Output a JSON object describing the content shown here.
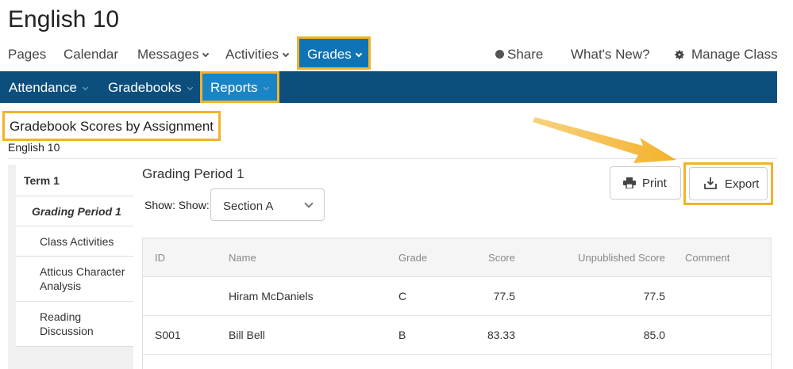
{
  "page": {
    "title": "English 10"
  },
  "topnav": {
    "pages": "Pages",
    "calendar": "Calendar",
    "messages": "Messages",
    "activities": "Activities",
    "grades": "Grades",
    "share": "Share",
    "whats_new": "What's New?",
    "manage_class": "Manage Class"
  },
  "subnav": {
    "attendance": "Attendance",
    "gradebooks": "Gradebooks",
    "reports": "Reports"
  },
  "report": {
    "title": "Gradebook Scores by Assignment",
    "subtitle": "English 10"
  },
  "sidebar": {
    "term": "Term 1",
    "period": "Grading Period 1",
    "items": [
      {
        "label": "Class Activities"
      },
      {
        "label": "Atticus Character Analysis"
      },
      {
        "label": "Reading Discussion"
      }
    ]
  },
  "main": {
    "period_title": "Grading Period 1",
    "show_label": "Show: Show:",
    "section_value": "Section A",
    "print_label": "Print",
    "export_label": "Export"
  },
  "table": {
    "headers": {
      "id": "ID",
      "name": "Name",
      "grade": "Grade",
      "score": "Score",
      "unpublished": "Unpublished Score",
      "comment": "Comment"
    },
    "rows": [
      {
        "id": "",
        "name": "Hiram McDaniels",
        "grade": "C",
        "score": "77.5",
        "unpublished": "77.5",
        "comment": ""
      },
      {
        "id": "S001",
        "name": "Bill Bell",
        "grade": "B",
        "score": "83.33",
        "unpublished": "85.0",
        "comment": ""
      }
    ]
  },
  "colors": {
    "subnav_bg": "#0c4f7d",
    "active_tab": "#0f74b5",
    "highlight": "#f3b22a"
  }
}
